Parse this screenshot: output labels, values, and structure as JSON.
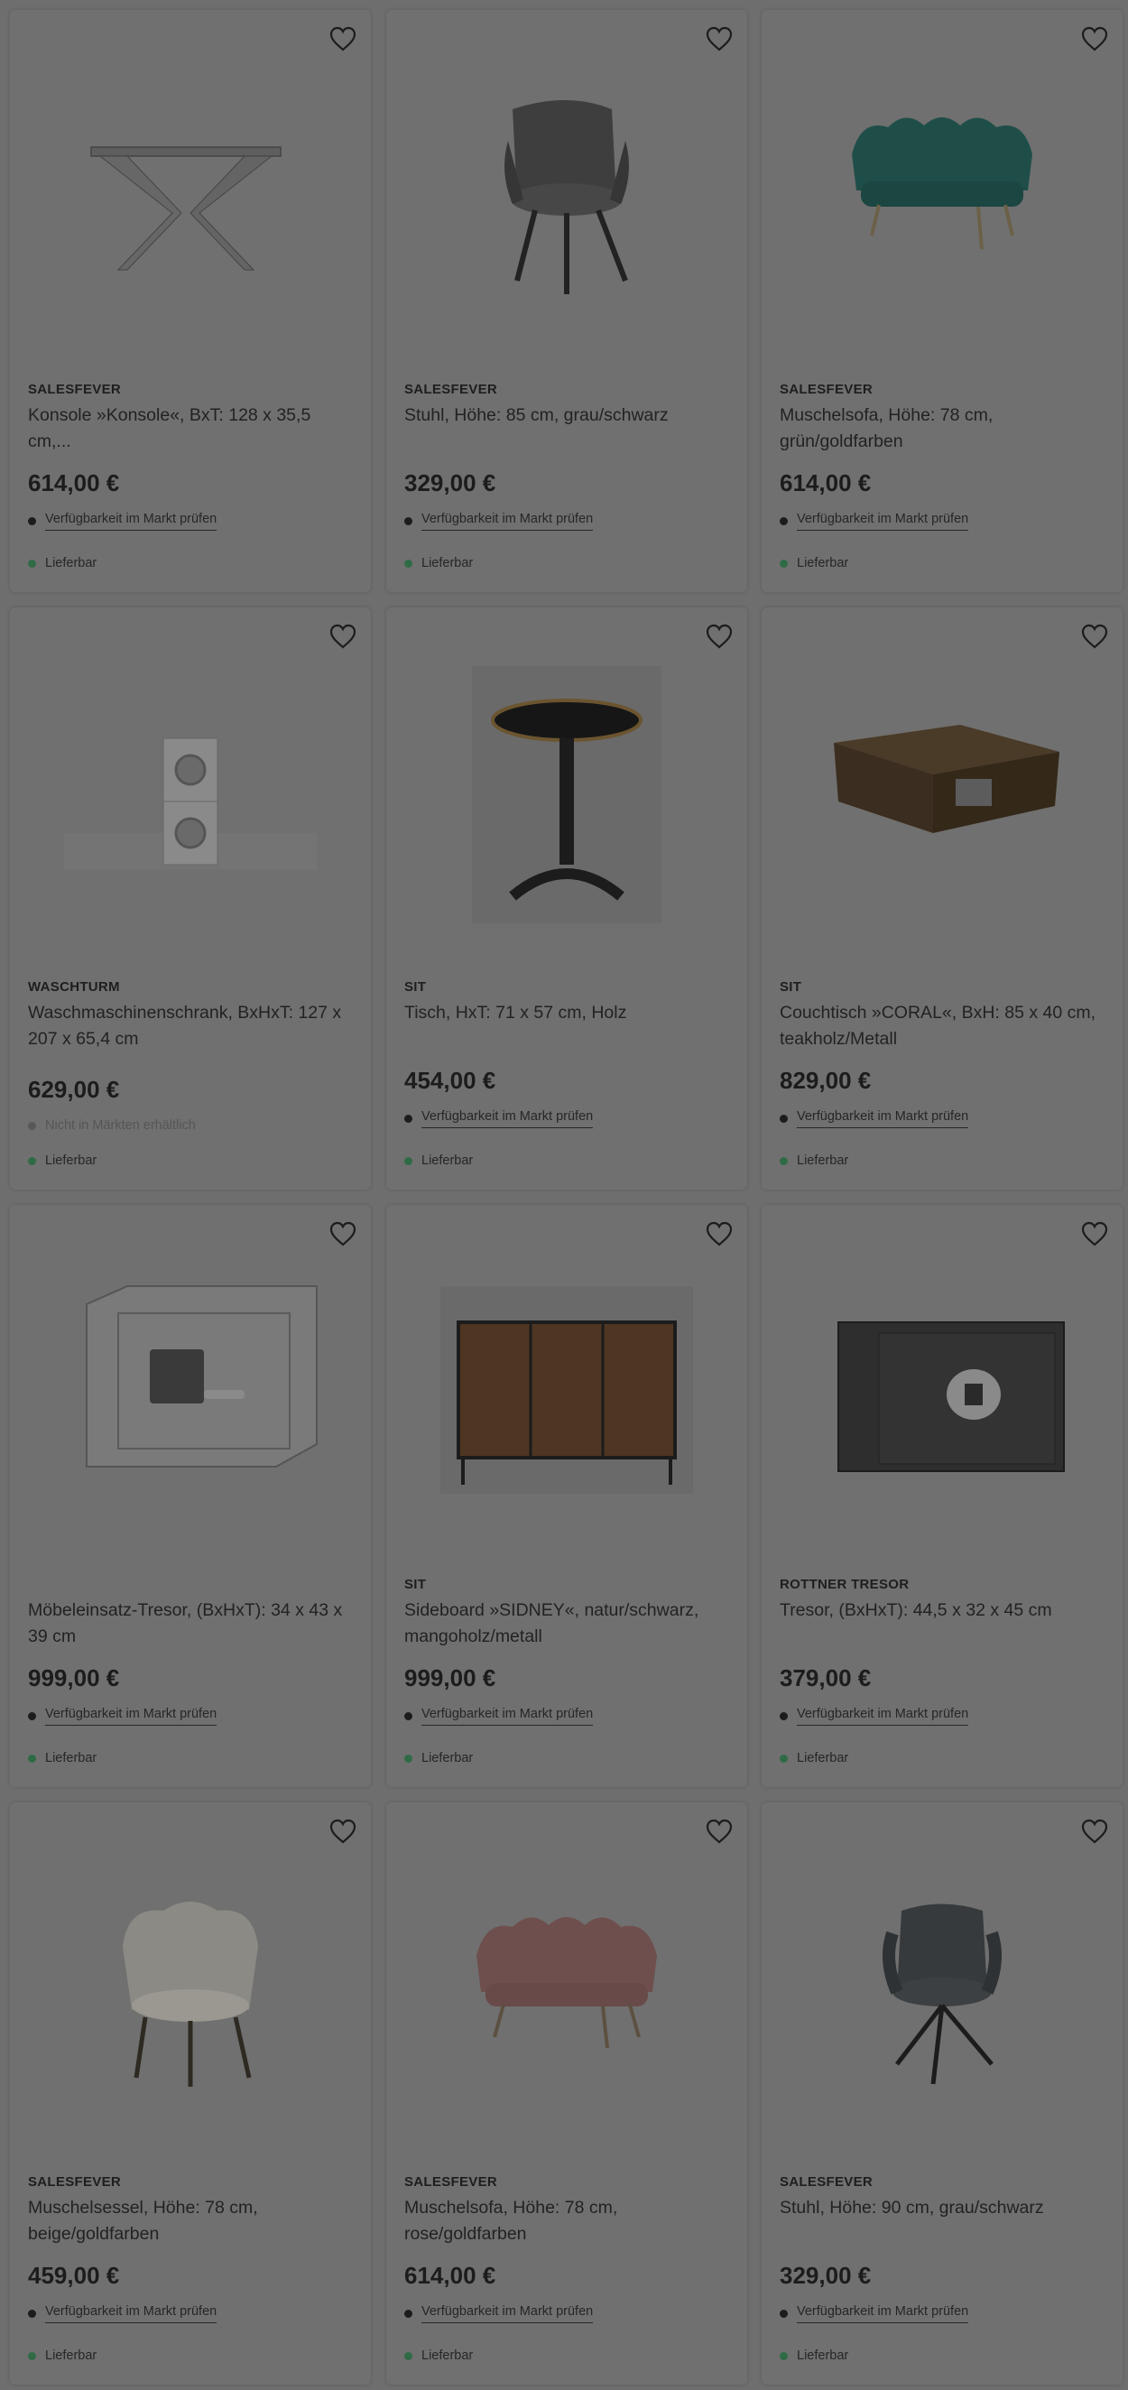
{
  "colors": {
    "overlay_bg": "#6e6e6e",
    "card_bg": "#707070",
    "delivery_dot": "#2f6b45"
  },
  "products": [
    {
      "brand": "SALESFEVER",
      "title": "Konsole »Konsole«, BxT: 128 x 35,5 cm,...",
      "price": "614,00 €",
      "availability": "Verfügbarkeit im Markt prüfen",
      "availability_link": true,
      "delivery": "Lieferbar",
      "image": "console-table-icon"
    },
    {
      "brand": "SALESFEVER",
      "title": "Stuhl, Höhe: 85 cm, grau/schwarz",
      "price": "329,00 €",
      "availability": "Verfügbarkeit im Markt prüfen",
      "availability_link": true,
      "delivery": "Lieferbar",
      "image": "armchair-icon"
    },
    {
      "brand": "SALESFEVER",
      "title": "Muschelsofa, Höhe: 78 cm, grün/goldfarben",
      "price": "614,00 €",
      "availability": "Verfügbarkeit im Markt prüfen",
      "availability_link": true,
      "delivery": "Lieferbar",
      "image": "shell-sofa-icon"
    },
    {
      "brand": "WASCHTURM",
      "title": "Waschmaschinenschrank, BxHxT: 127 x 207 x 65,4 cm",
      "price": "629,00 €",
      "availability": "Nicht in Märkten erhältlich",
      "availability_link": false,
      "delivery": "Lieferbar",
      "image": "washer-tower-icon"
    },
    {
      "brand": "SIT",
      "title": "Tisch, HxT: 71 x 57 cm, Holz",
      "price": "454,00 €",
      "availability": "Verfügbarkeit im Markt prüfen",
      "availability_link": true,
      "delivery": "Lieferbar",
      "image": "bistro-table-icon"
    },
    {
      "brand": "SIT",
      "title": "Couchtisch »CORAL«, BxH: 85 x 40 cm, teakholz/Metall",
      "price": "829,00 €",
      "availability": "Verfügbarkeit im Markt prüfen",
      "availability_link": true,
      "delivery": "Lieferbar",
      "image": "coffee-table-icon"
    },
    {
      "brand": "",
      "title": "Möbeleinsatz-Tresor, (BxHxT): 34 x 43 x 39 cm",
      "price": "999,00 €",
      "availability": "Verfügbarkeit im Markt prüfen",
      "availability_link": true,
      "delivery": "Lieferbar",
      "image": "safe-light-icon"
    },
    {
      "brand": "SIT",
      "title": "Sideboard »SIDNEY«, natur/schwarz, mangoholz/metall",
      "price": "999,00 €",
      "availability": "Verfügbarkeit im Markt prüfen",
      "availability_link": true,
      "delivery": "Lieferbar",
      "image": "sideboard-icon"
    },
    {
      "brand": "ROTTNER TRESOR",
      "title": "Tresor, (BxHxT): 44,5 x 32 x 45 cm",
      "price": "379,00 €",
      "availability": "Verfügbarkeit im Markt prüfen",
      "availability_link": true,
      "delivery": "Lieferbar",
      "image": "safe-dark-icon"
    },
    {
      "brand": "SALESFEVER",
      "title": "Muschelsessel, Höhe: 78 cm, beige/goldfarben",
      "price": "459,00 €",
      "availability": "Verfügbarkeit im Markt prüfen",
      "availability_link": true,
      "delivery": "Lieferbar",
      "image": "shell-chair-icon"
    },
    {
      "brand": "SALESFEVER",
      "title": "Muschelsofa, Höhe: 78 cm, rose/goldfarben",
      "price": "614,00 €",
      "availability": "Verfügbarkeit im Markt prüfen",
      "availability_link": true,
      "delivery": "Lieferbar",
      "image": "shell-sofa-rose-icon"
    },
    {
      "brand": "SALESFEVER",
      "title": "Stuhl, Höhe: 90 cm, grau/schwarz",
      "price": "329,00 €",
      "availability": "Verfügbarkeit im Markt prüfen",
      "availability_link": true,
      "delivery": "Lieferbar",
      "image": "swivel-chair-icon"
    }
  ]
}
